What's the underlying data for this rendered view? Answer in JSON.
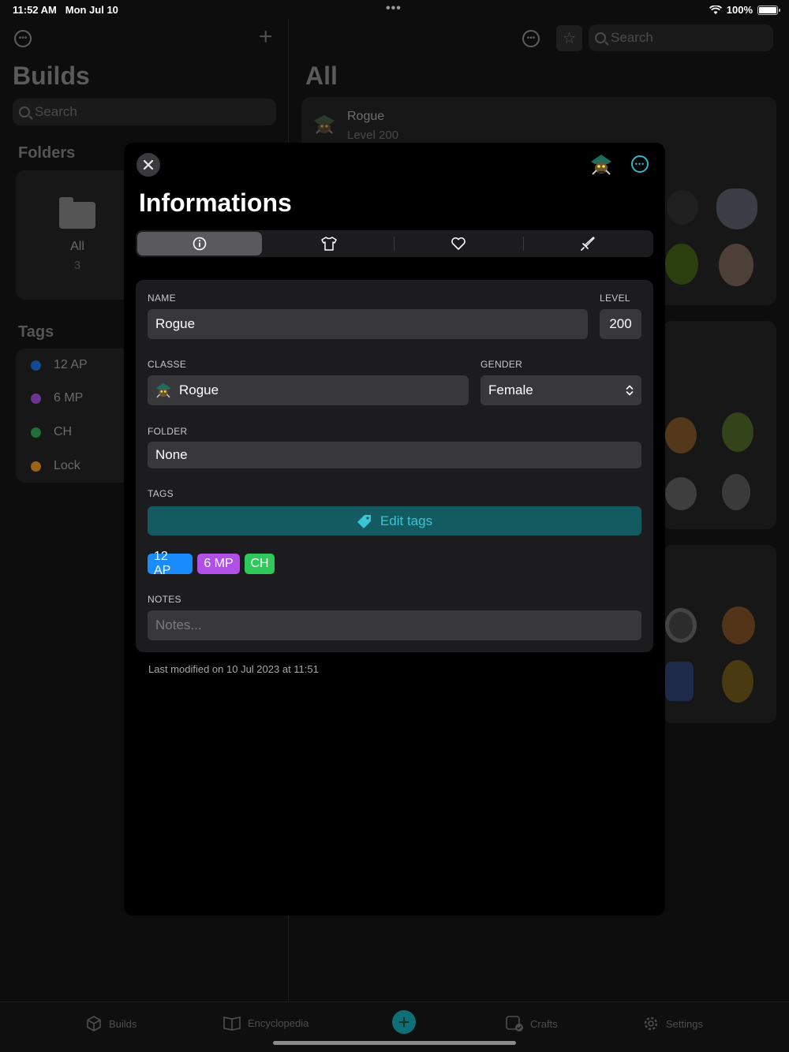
{
  "status_bar": {
    "time": "11:52 AM",
    "date": "Mon Jul 10",
    "battery": "100%",
    "dots": "•••"
  },
  "sidebar": {
    "title": "Builds",
    "search_placeholder": "Search",
    "folders_title": "Folders",
    "folders": [
      {
        "label": "All",
        "count": "3"
      }
    ],
    "tags_title": "Tags",
    "tags": [
      {
        "label": "12 AP",
        "color": "#1a73e8"
      },
      {
        "label": "6 MP",
        "color": "#9b4fd6"
      },
      {
        "label": "CH",
        "color": "#2fa84f"
      },
      {
        "label": "Lock",
        "color": "#e2921c"
      }
    ]
  },
  "main": {
    "title": "All",
    "search_placeholder": "Search",
    "first_build": {
      "name": "Rogue",
      "level": "Level 200"
    }
  },
  "sheet": {
    "title": "Informations",
    "segments": [
      {
        "icon": "info-icon",
        "active": true
      },
      {
        "icon": "shirt-icon",
        "active": false
      },
      {
        "icon": "heart-icon",
        "active": false
      },
      {
        "icon": "sword-icon",
        "active": false
      }
    ],
    "form": {
      "name_label": "NAME",
      "name_value": "Rogue",
      "level_label": "LEVEL",
      "level_value": "200",
      "class_label": "CLASSE",
      "class_value": "Rogue",
      "gender_label": "GENDER",
      "gender_value": "Female",
      "folder_label": "FOLDER",
      "folder_value": "None",
      "tags_label": "TAGS",
      "edit_tags_label": "Edit tags",
      "chips": [
        {
          "label": "12 AP",
          "color": "#1a8cff"
        },
        {
          "label": "6 MP",
          "color": "#b050e6"
        },
        {
          "label": "CH",
          "color": "#2ec95a"
        }
      ],
      "notes_label": "NOTES",
      "notes_placeholder": "Notes..."
    },
    "modified": "Last modified on 10 Jul 2023 at 11:51"
  },
  "tabbar": {
    "items": [
      {
        "label": "Builds",
        "icon": "cube-icon"
      },
      {
        "label": "Encyclopedia",
        "icon": "book-icon"
      },
      {
        "label": "Crafts",
        "icon": "crafts-icon"
      },
      {
        "label": "Settings",
        "icon": "gear-icon"
      }
    ],
    "accent": "#0e6f78"
  }
}
